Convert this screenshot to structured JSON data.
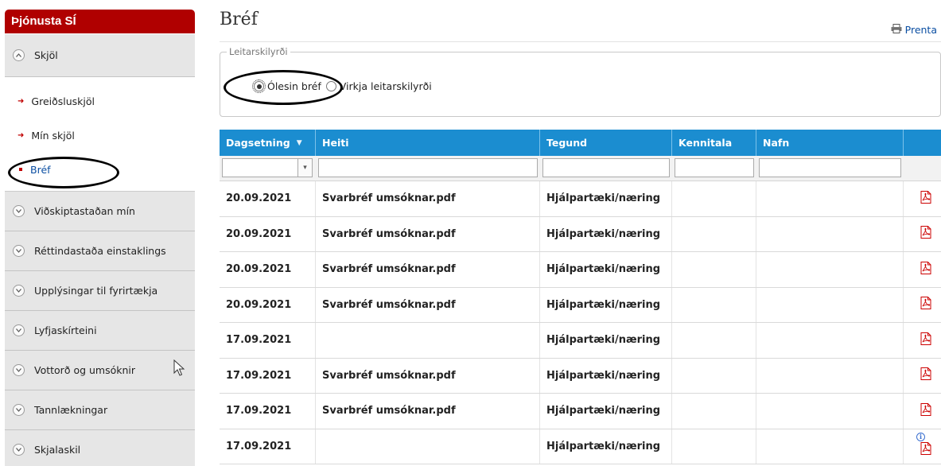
{
  "sidebar": {
    "header": "Þjónusta SÍ",
    "top_section": "Skjöl",
    "subitems": [
      {
        "label": "Greiðsluskjöl"
      },
      {
        "label": "Mín skjöl"
      },
      {
        "label": "Bréf"
      }
    ],
    "sections": [
      {
        "label": "Viðskiptastaðan mín"
      },
      {
        "label": "Réttindastaða einstaklings"
      },
      {
        "label": "Upplýsingar til fyrirtækja"
      },
      {
        "label": "Lyfjaskírteini"
      },
      {
        "label": "Vottorð og umsóknir"
      },
      {
        "label": "Tannlækningar"
      },
      {
        "label": "Skjalaskil"
      }
    ]
  },
  "main": {
    "title": "Bréf",
    "print_label": "Prenta",
    "search_criteria": {
      "legend": "Leitarskilyrði",
      "option_unread": "Ólesin bréf",
      "option_active": "Virkja leitarskilyrði",
      "selected": "Ólesin bréf"
    }
  },
  "table": {
    "columns": [
      "Dagsetning",
      "Heiti",
      "Tegund",
      "Kennitala",
      "Nafn",
      ""
    ],
    "rows": [
      {
        "date": "20.09.2021",
        "name": "Svarbréf umsóknar.pdf",
        "type": "Hjálpartæki/næring",
        "kennitala": "",
        "nafn": ""
      },
      {
        "date": "20.09.2021",
        "name": "Svarbréf umsóknar.pdf",
        "type": "Hjálpartæki/næring",
        "kennitala": "",
        "nafn": ""
      },
      {
        "date": "20.09.2021",
        "name": "Svarbréf umsóknar.pdf",
        "type": "Hjálpartæki/næring",
        "kennitala": "",
        "nafn": ""
      },
      {
        "date": "20.09.2021",
        "name": "Svarbréf umsóknar.pdf",
        "type": "Hjálpartæki/næring",
        "kennitala": "",
        "nafn": ""
      },
      {
        "date": "17.09.2021",
        "name": "",
        "type": "Hjálpartæki/næring",
        "kennitala": "",
        "nafn": ""
      },
      {
        "date": "17.09.2021",
        "name": "Svarbréf umsóknar.pdf",
        "type": "Hjálpartæki/næring",
        "kennitala": "",
        "nafn": ""
      },
      {
        "date": "17.09.2021",
        "name": "Svarbréf umsóknar.pdf",
        "type": "Hjálpartæki/næring",
        "kennitala": "",
        "nafn": ""
      },
      {
        "date": "17.09.2021",
        "name": "",
        "type": "Hjálpartæki/næring",
        "kennitala": "",
        "nafn": "",
        "has_info": true
      }
    ]
  },
  "icons": {
    "pdf": "pdf-file-icon",
    "info": "info-icon",
    "print": "printer-icon",
    "sort": "sort-descending-icon"
  },
  "colors": {
    "brand_red": "#b00000",
    "table_header_blue": "#1b8dd0",
    "link_blue": "#0a4ea2"
  }
}
